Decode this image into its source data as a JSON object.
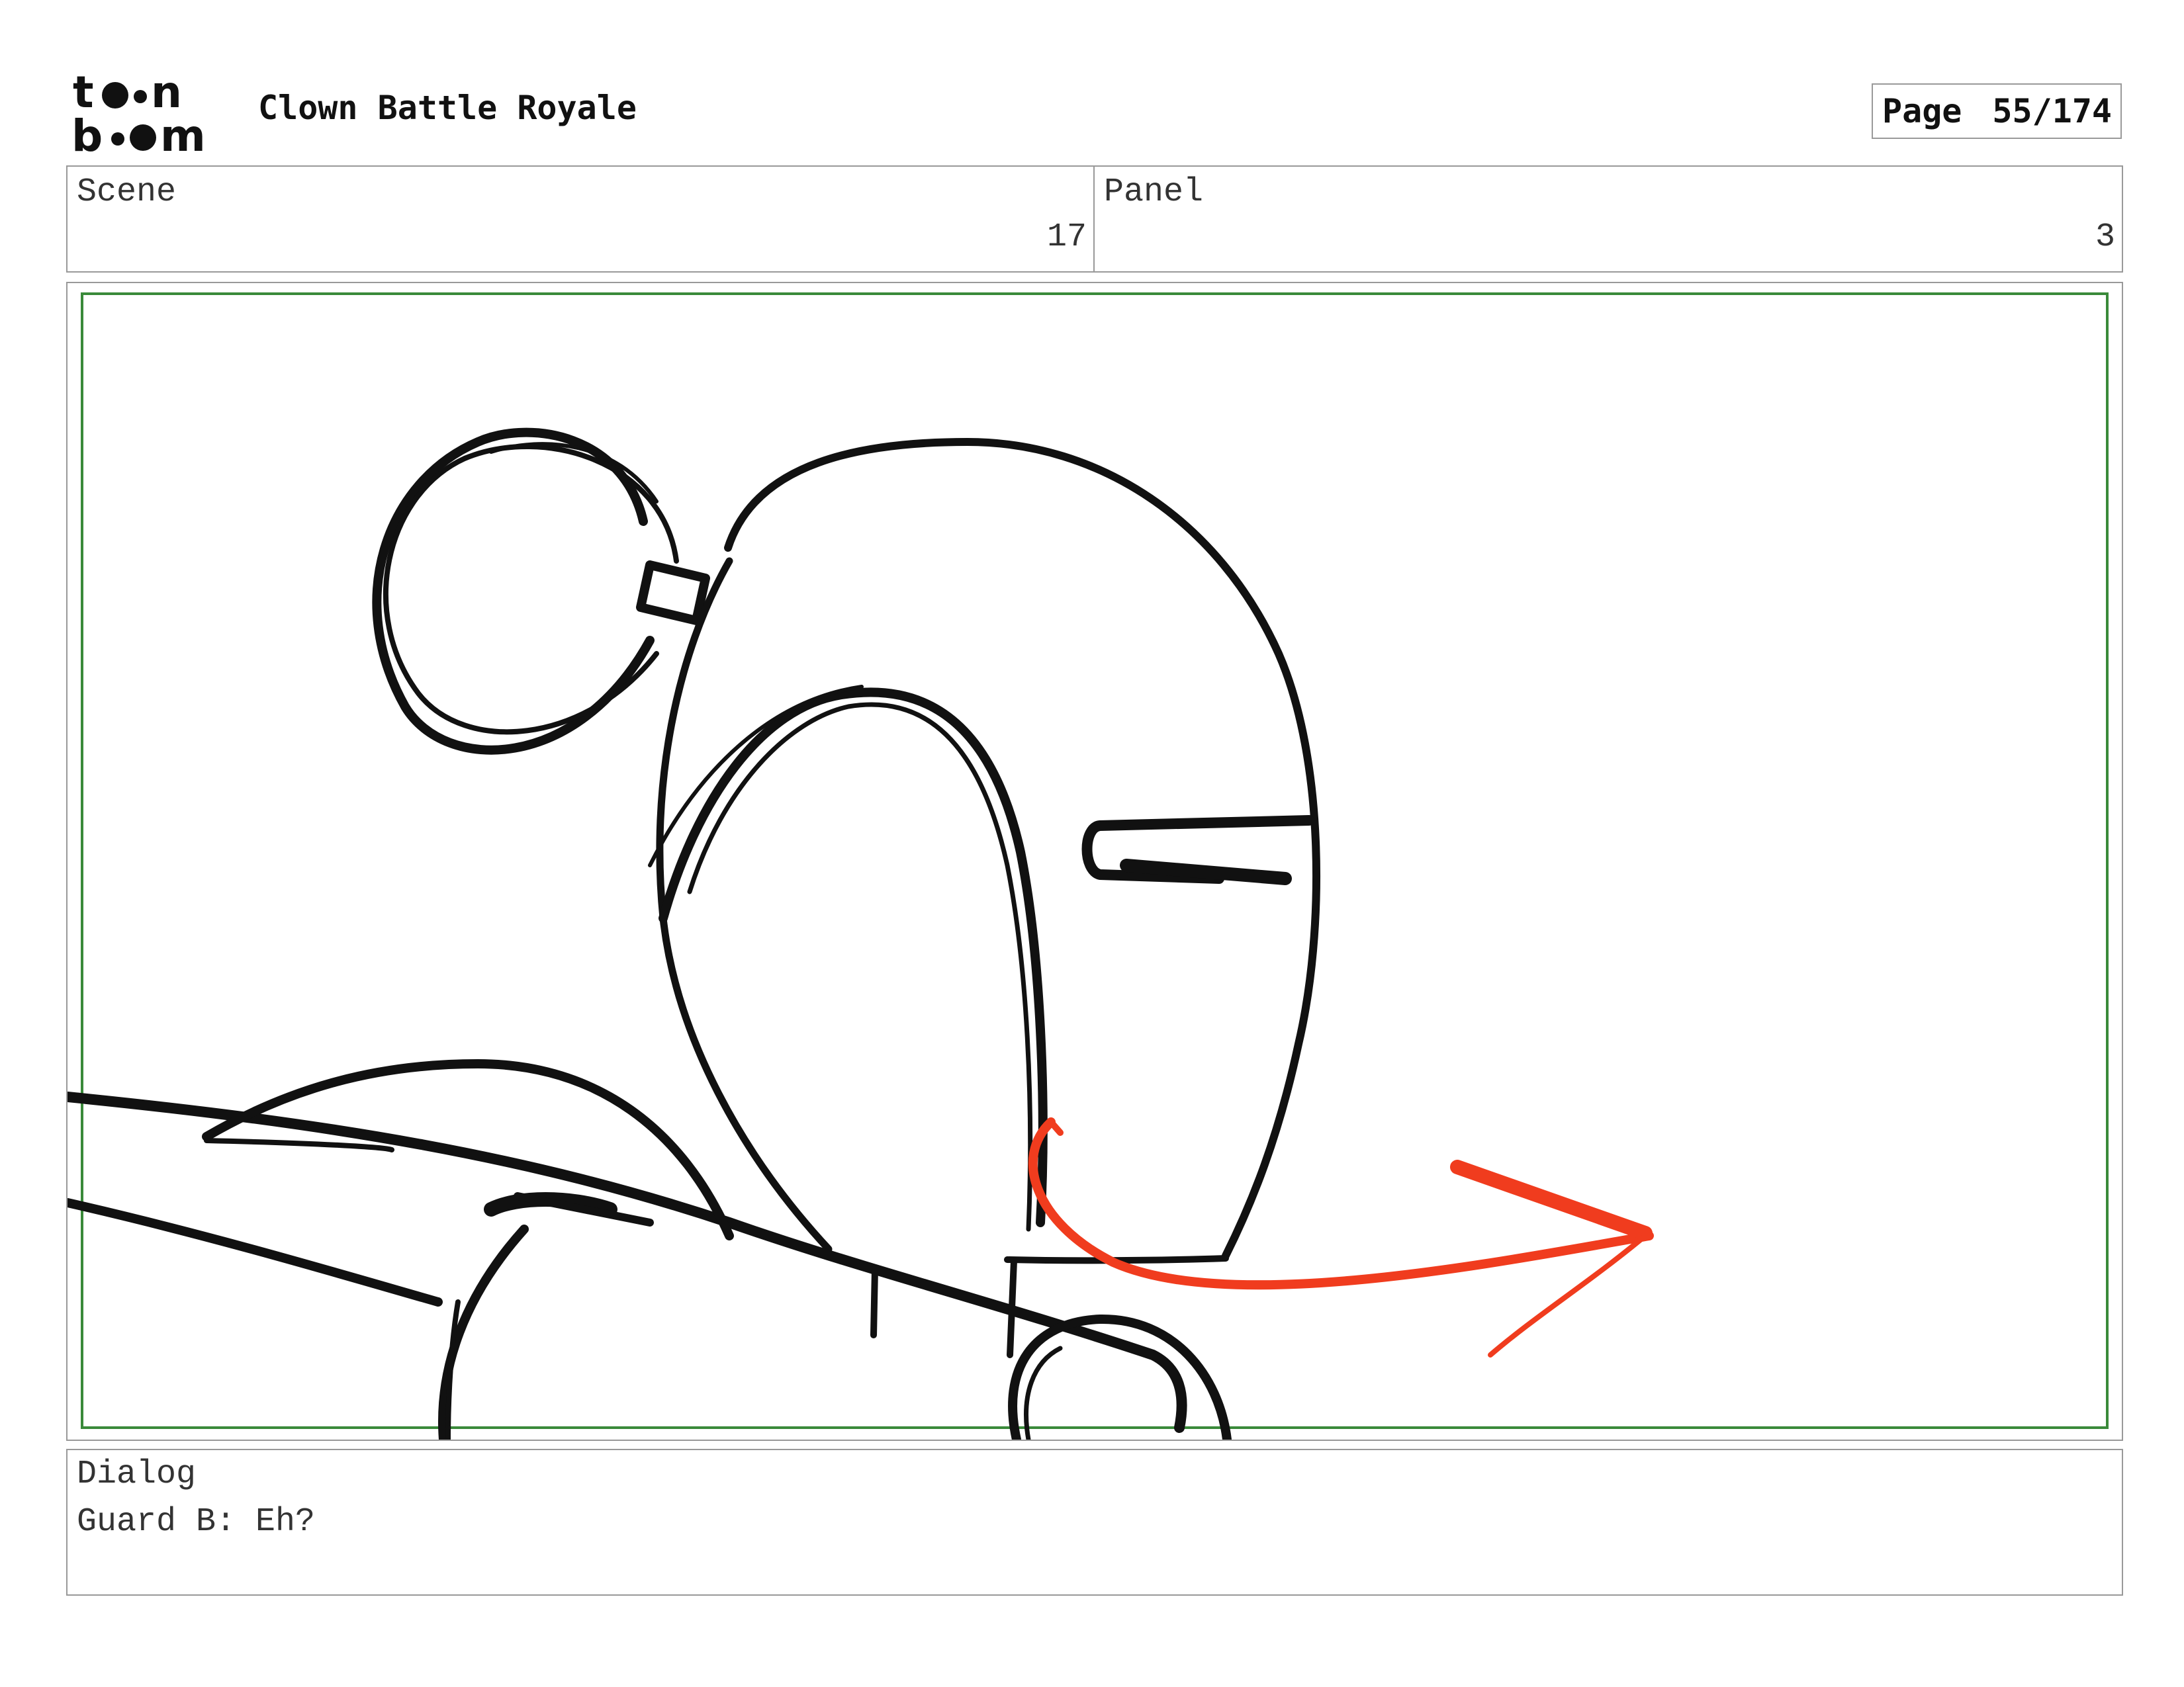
{
  "header": {
    "logo": {
      "name": "toon-boom-logo",
      "line1": "toon",
      "line2": "boom"
    },
    "project_title": "Clown Battle Royale",
    "page_label": "Page",
    "page_value": "55/174"
  },
  "scene": {
    "label": "Scene",
    "value": "17"
  },
  "panel": {
    "label": "Panel",
    "value": "3"
  },
  "drawing": {
    "content": "rough storyboard sketch: clown guard with hair bun and round helmet, red motion arrow pointing right",
    "stroke_color": "#111111",
    "arrow_color": "#f03c1e",
    "safe_frame_color": "#3a8a3a"
  },
  "dialog": {
    "label": "Dialog",
    "text": "Guard B: Eh?"
  }
}
